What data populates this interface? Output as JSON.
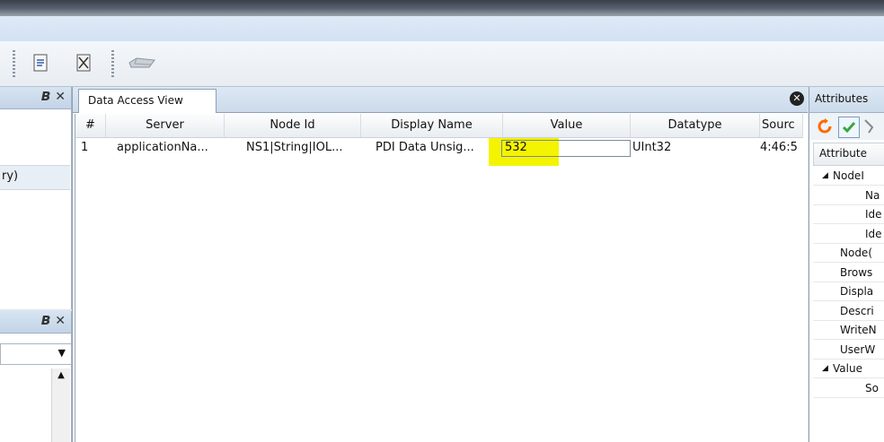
{
  "toolbar": {
    "icons": [
      "document-icon",
      "delete-document-icon",
      "device-icon"
    ]
  },
  "left_panes": [
    {
      "item_text": "ry)"
    },
    {
      "combo_value": ""
    }
  ],
  "tab": {
    "label": "Data Access View"
  },
  "grid": {
    "headers": [
      "#",
      "Server",
      "Node Id",
      "Display Name",
      "Value",
      "Datatype",
      "Sourc"
    ],
    "rows": [
      {
        "num": "1",
        "server": "applicationNa...",
        "node_id": "NS1|String|IOL...",
        "display_name": "PDI Data Unsig...",
        "value": "532",
        "datatype": "UInt32",
        "source": "4:46:5"
      }
    ]
  },
  "attributes": {
    "title": "Attributes",
    "column": "Attribute",
    "items": [
      {
        "expander": "◢",
        "label": "NodeI",
        "indent": 1
      },
      {
        "expander": "",
        "label": "Na",
        "indent": 3
      },
      {
        "expander": "",
        "label": "Ide",
        "indent": 3
      },
      {
        "expander": "",
        "label": "Ide",
        "indent": 3
      },
      {
        "expander": "",
        "label": "Node(",
        "indent": 2
      },
      {
        "expander": "",
        "label": "Brows",
        "indent": 2
      },
      {
        "expander": "",
        "label": "Displa",
        "indent": 2
      },
      {
        "expander": "",
        "label": "Descri",
        "indent": 2
      },
      {
        "expander": "",
        "label": "WriteN",
        "indent": 2
      },
      {
        "expander": "",
        "label": "UserW",
        "indent": 2
      },
      {
        "expander": "◢",
        "label": "Value",
        "indent": 1
      },
      {
        "expander": "",
        "label": "So",
        "indent": 3
      }
    ]
  },
  "colors": {
    "highlight": "#f4f400",
    "accent": "#ff6a00"
  }
}
